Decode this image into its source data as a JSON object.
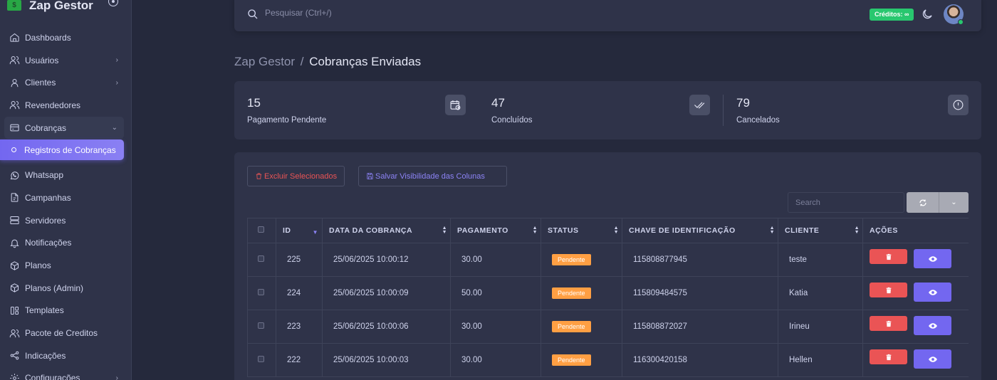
{
  "app": {
    "name": "Zap Gestor",
    "logo_glyph": "$"
  },
  "sidebar": {
    "items": [
      {
        "label": "Dashboards",
        "icon": "home-icon"
      },
      {
        "label": "Usuários",
        "icon": "users-icon",
        "chevron": true
      },
      {
        "label": "Clientes",
        "icon": "user-icon",
        "chevron": true
      },
      {
        "label": "Revendedores",
        "icon": "users-icon"
      },
      {
        "label": "Cobranças",
        "icon": "credit-card-icon",
        "open": true
      },
      {
        "label": "Registros de Cobranças",
        "active": true
      },
      {
        "label": "Whatsapp",
        "icon": "whatsapp-icon"
      },
      {
        "label": "Campanhas",
        "icon": "file-icon"
      },
      {
        "label": "Servidores",
        "icon": "server-icon"
      },
      {
        "label": "Notificações",
        "icon": "bell-icon"
      },
      {
        "label": "Planos",
        "icon": "package-icon"
      },
      {
        "label": "Planos (Admin)",
        "icon": "package-icon"
      },
      {
        "label": "Templates",
        "icon": "layout-icon"
      },
      {
        "label": "Pacote de Creditos",
        "icon": "users-icon"
      },
      {
        "label": "Indicações",
        "icon": "share-icon"
      },
      {
        "label": "Configurações",
        "icon": "settings-icon",
        "chevron": true
      }
    ]
  },
  "topbar": {
    "search_placeholder": "Pesquisar (Ctrl+/)",
    "credits_label": "Créditos: ∞"
  },
  "breadcrumb": {
    "root": "Zap Gestor",
    "separator": "/",
    "current": "Cobranças Enviadas"
  },
  "stats": [
    {
      "value": "15",
      "label": "Pagamento Pendente",
      "icon": "calendar-clock-icon"
    },
    {
      "value": "47",
      "label": "Concluídos",
      "icon": "double-check-icon"
    },
    {
      "value": "79",
      "label": "Cancelados",
      "icon": "alert-circle-icon"
    }
  ],
  "toolbar": {
    "delete_selected": "Excluir Selecionados",
    "save_visibility": "Salvar Visibilidade das Colunas",
    "search_placeholder": "Search"
  },
  "table": {
    "headers": [
      "ID",
      "DATA DA COBRANÇA",
      "PAGAMENTO",
      "STATUS",
      "CHAVE DE IDENTIFICAÇÃO",
      "CLIENTE",
      "AÇÕES"
    ],
    "rows": [
      {
        "id": "225",
        "date": "25/06/2025 10:00:12",
        "payment": "30.00",
        "status": "Pendente",
        "key": "115808877945",
        "client": "teste"
      },
      {
        "id": "224",
        "date": "25/06/2025 10:00:09",
        "payment": "50.00",
        "status": "Pendente",
        "key": "115809484575",
        "client": "Katia"
      },
      {
        "id": "223",
        "date": "25/06/2025 10:00:06",
        "payment": "30.00",
        "status": "Pendente",
        "key": "115808872027",
        "client": "Irineu"
      },
      {
        "id": "222",
        "date": "25/06/2025 10:00:03",
        "payment": "30.00",
        "status": "Pendente",
        "key": "116300420158",
        "client": "Hellen"
      }
    ]
  },
  "colors": {
    "accent": "#7367f0",
    "success": "#28c76f",
    "danger": "#ea5455",
    "warning": "#ff9f43"
  }
}
